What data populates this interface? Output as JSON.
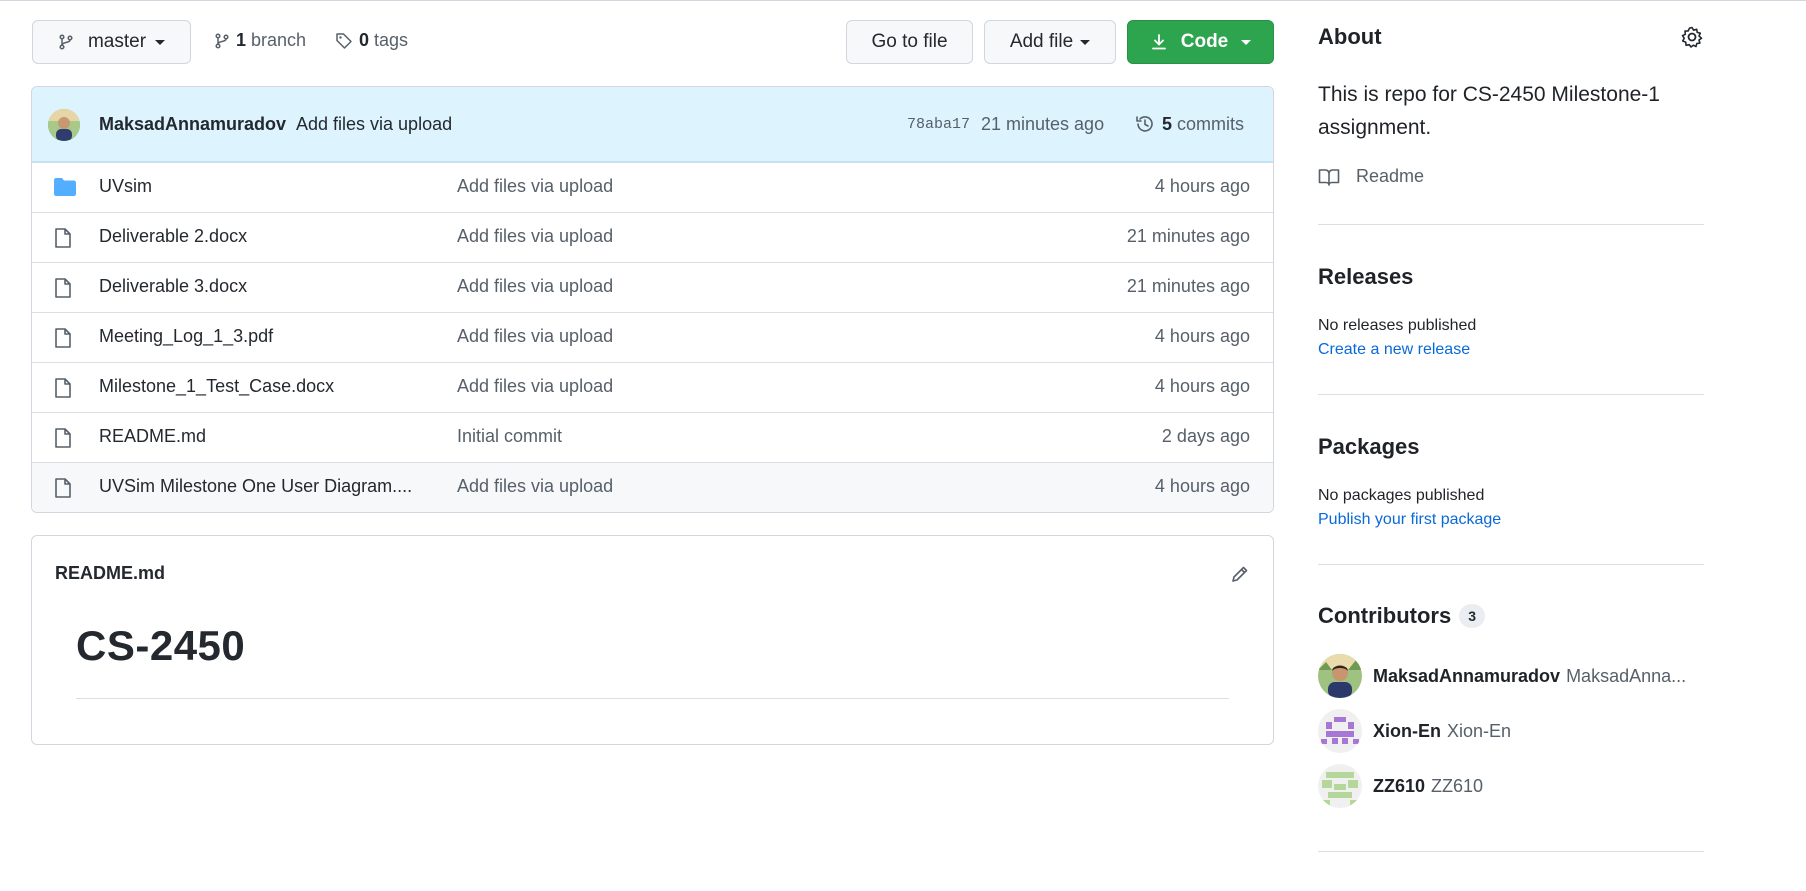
{
  "toolbar": {
    "branch_name": "master",
    "branches_count": "1",
    "branches_label": "branch",
    "tags_count": "0",
    "tags_label": "tags",
    "go_to_file": "Go to file",
    "add_file": "Add file",
    "code": "Code"
  },
  "commit": {
    "author": "MaksadAnnamuradov",
    "message": "Add files via upload",
    "hash": "78aba17",
    "time": "21 minutes ago",
    "commits_count": "5",
    "commits_label": "commits"
  },
  "files": [
    {
      "name": "UVsim",
      "message": "Add files via upload",
      "age": "4 hours ago",
      "type": "folder"
    },
    {
      "name": "Deliverable 2.docx",
      "message": "Add files via upload",
      "age": "21 minutes ago",
      "type": "file"
    },
    {
      "name": "Deliverable 3.docx",
      "message": "Add files via upload",
      "age": "21 minutes ago",
      "type": "file"
    },
    {
      "name": "Meeting_Log_1_3.pdf",
      "message": "Add files via upload",
      "age": "4 hours ago",
      "type": "file"
    },
    {
      "name": "Milestone_1_Test_Case.docx",
      "message": "Add files via upload",
      "age": "4 hours ago",
      "type": "file"
    },
    {
      "name": "README.md",
      "message": "Initial commit",
      "age": "2 days ago",
      "type": "file"
    },
    {
      "name": "UVSim Milestone One User Diagram....",
      "message": "Add files via upload",
      "age": "4 hours ago",
      "type": "file"
    }
  ],
  "readme": {
    "filename": "README.md",
    "heading": "CS-2450"
  },
  "sidebar": {
    "about_title": "About",
    "description": "This is repo for CS-2450 Milestone-1 assignment.",
    "readme_link": "Readme",
    "releases_title": "Releases",
    "releases_text": "No releases published",
    "releases_link": "Create a new release",
    "packages_title": "Packages",
    "packages_text": "No packages published",
    "packages_link": "Publish your first package",
    "contributors_title": "Contributors",
    "contributors_count": "3",
    "contributors": [
      {
        "name": "MaksadAnnamuradov",
        "login": "MaksadAnna..."
      },
      {
        "name": "Xion-En",
        "login": "Xion-En"
      },
      {
        "name": "ZZ610",
        "login": "ZZ610"
      }
    ]
  },
  "colors": {
    "primary_green": "#2da44e",
    "link_blue": "#0969da",
    "folder_blue": "#54aeff"
  }
}
